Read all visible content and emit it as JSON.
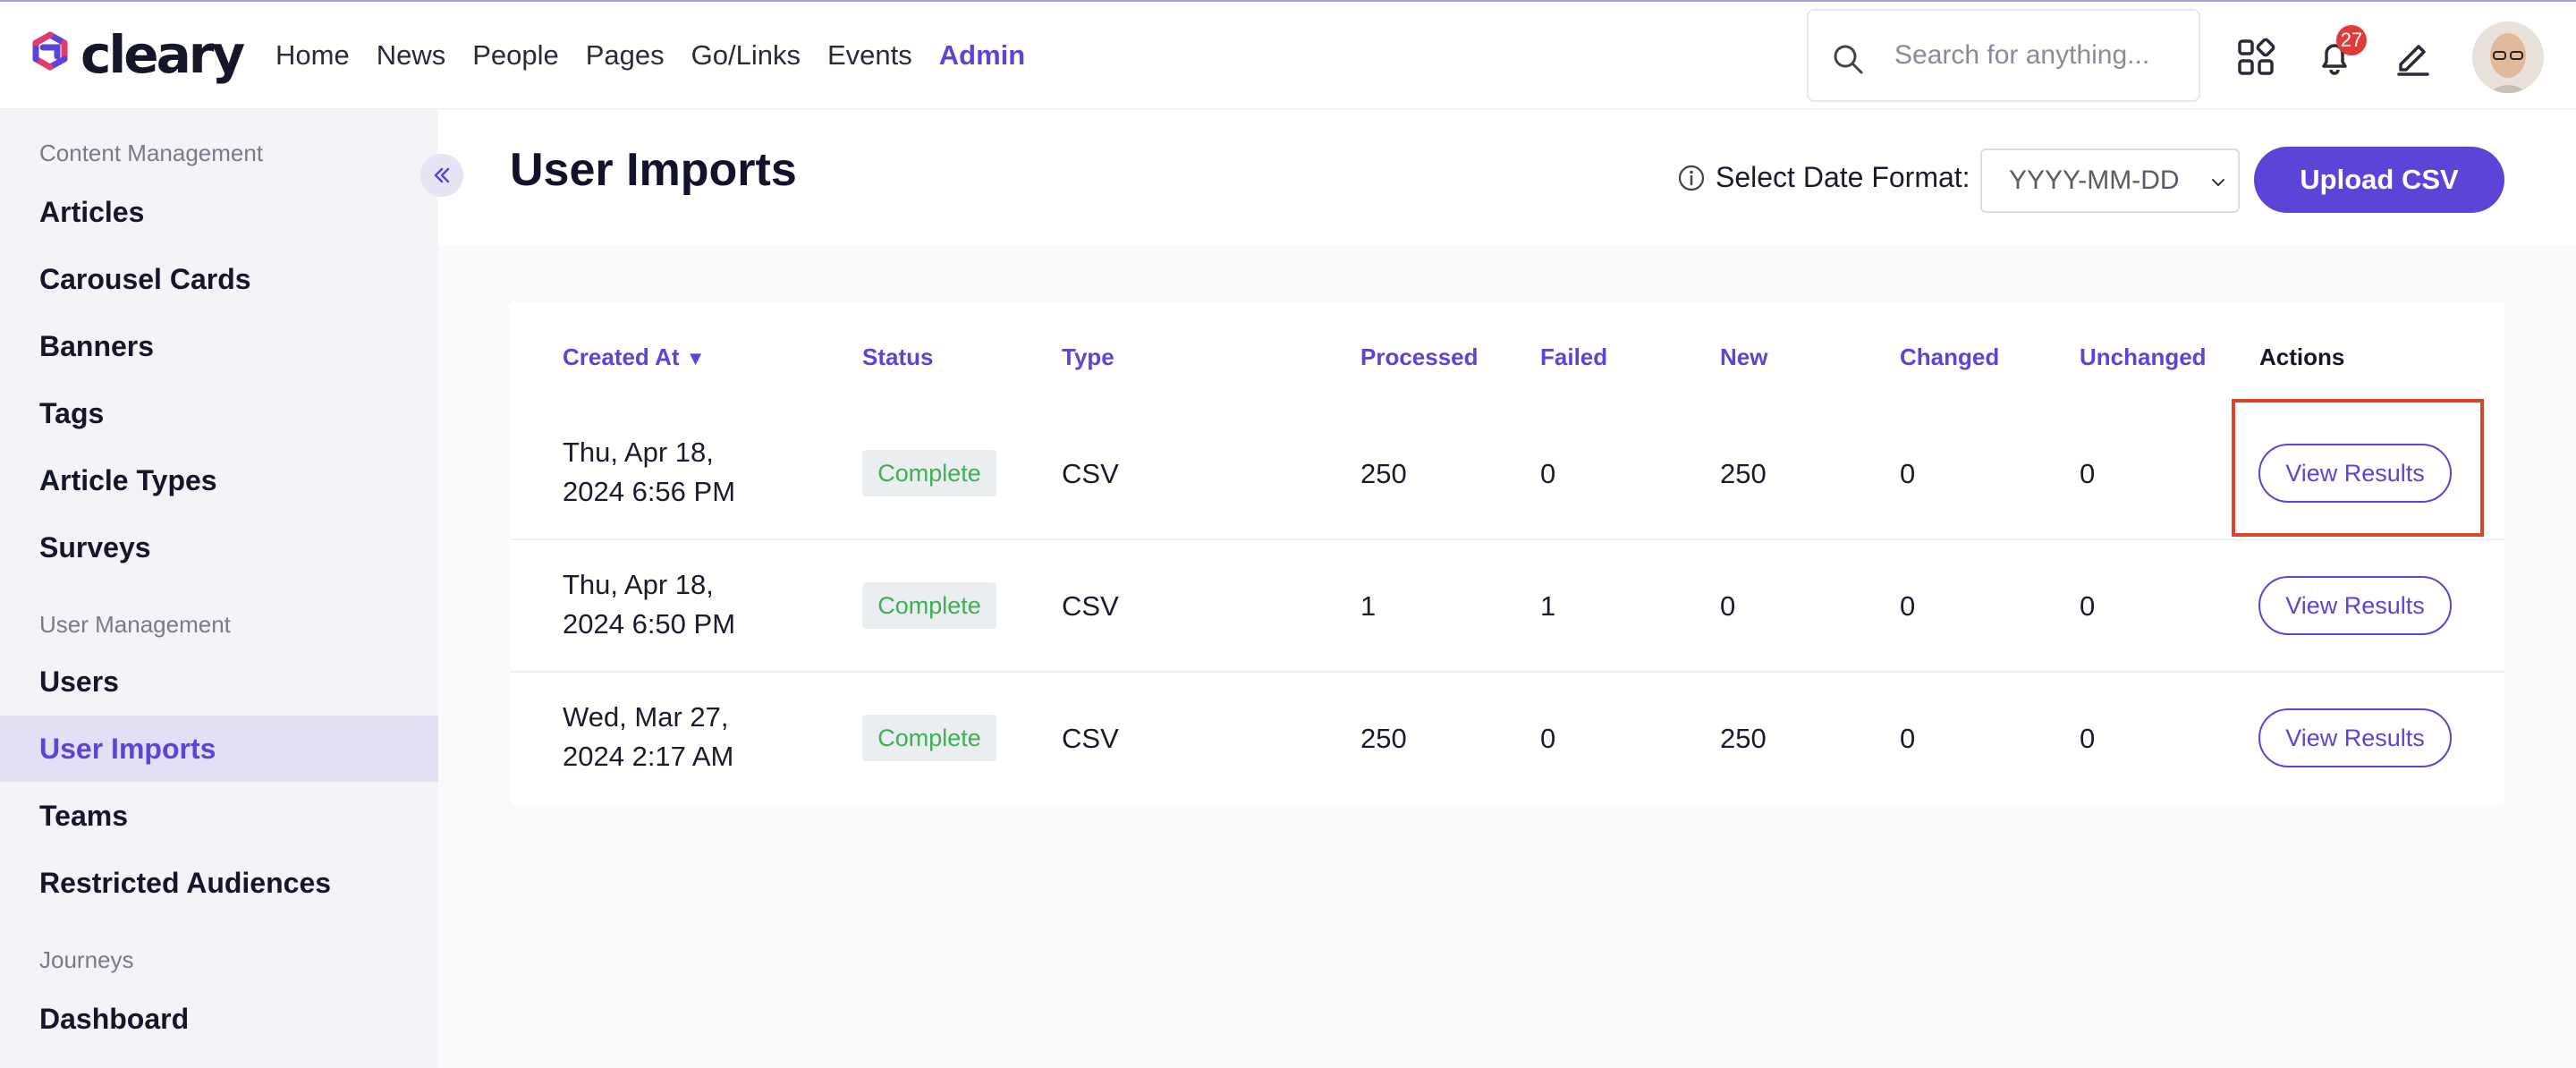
{
  "app": {
    "logo_text": "cleary",
    "colors": {
      "accent": "#5a45d6",
      "badge": "#e03b3b",
      "status_green": "#3fae55",
      "highlight": "#d9442e"
    }
  },
  "nav": {
    "items": [
      "Home",
      "News",
      "People",
      "Pages",
      "Go/Links",
      "Events",
      "Admin"
    ],
    "active": "Admin"
  },
  "search": {
    "placeholder": "Search for anything..."
  },
  "header_icons": {
    "apps": "grid-icon",
    "notifications": "bell-icon",
    "notifications_count": "27",
    "compose": "pencil-icon"
  },
  "sidebar": {
    "sections": [
      {
        "title": "Content Management",
        "items": [
          "Articles",
          "Carousel Cards",
          "Banners",
          "Tags",
          "Article Types",
          "Surveys"
        ]
      },
      {
        "title": "User Management",
        "items": [
          "Users",
          "User Imports",
          "Teams",
          "Restricted Audiences"
        ]
      },
      {
        "title": "Journeys",
        "items": [
          "Dashboard"
        ]
      }
    ],
    "active": "User Imports"
  },
  "page": {
    "title": "User Imports",
    "date_format_label": "Select Date Format:",
    "date_format_value": "YYYY-MM-DD",
    "upload_button": "Upload CSV"
  },
  "table": {
    "columns": [
      "Created At",
      "Status",
      "Type",
      "Processed",
      "Failed",
      "New",
      "Changed",
      "Unchanged",
      "Actions"
    ],
    "sort_indicator": "▼",
    "rows": [
      {
        "created_line1": "Thu, Apr 18,",
        "created_line2": "2024 6:56 PM",
        "status": "Complete",
        "type": "CSV",
        "processed": "250",
        "failed": "0",
        "new": "250",
        "changed": "0",
        "unchanged": "0",
        "action": "View Results"
      },
      {
        "created_line1": "Thu, Apr 18,",
        "created_line2": "2024 6:50 PM",
        "status": "Complete",
        "type": "CSV",
        "processed": "1",
        "failed": "1",
        "new": "0",
        "changed": "0",
        "unchanged": "0",
        "action": "View Results"
      },
      {
        "created_line1": "Wed, Mar 27,",
        "created_line2": "2024 2:17 AM",
        "status": "Complete",
        "type": "CSV",
        "processed": "250",
        "failed": "0",
        "new": "250",
        "changed": "0",
        "unchanged": "0",
        "action": "View Results"
      }
    ]
  }
}
